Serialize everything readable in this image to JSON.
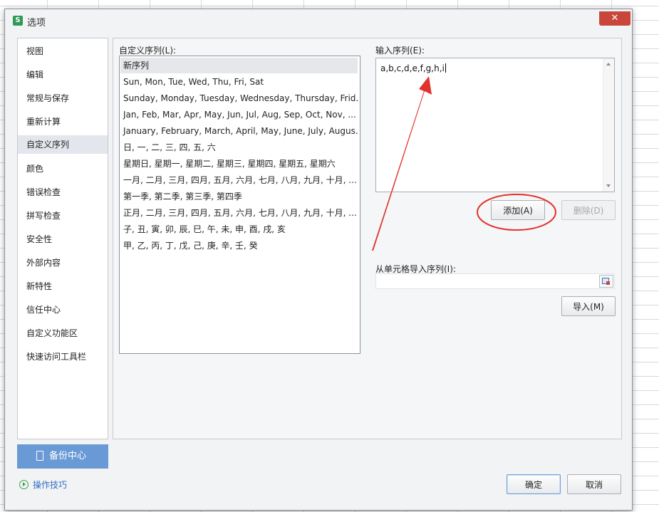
{
  "dialog": {
    "title": "选项",
    "app_icon_letter": "S",
    "close_glyph": "✕"
  },
  "nav": {
    "items": [
      {
        "label": "视图"
      },
      {
        "label": "编辑"
      },
      {
        "label": "常规与保存"
      },
      {
        "label": "重新计算"
      },
      {
        "label": "自定义序列"
      },
      {
        "label": "颜色"
      },
      {
        "label": "错误检查"
      },
      {
        "label": "拼写检查"
      },
      {
        "label": "安全性"
      },
      {
        "label": "外部内容"
      },
      {
        "label": "新特性"
      },
      {
        "label": "信任中心"
      },
      {
        "label": "自定义功能区"
      },
      {
        "label": "快速访问工具栏"
      }
    ],
    "active": "自定义序列"
  },
  "backup": {
    "label": "备份中心"
  },
  "tips": {
    "label": "操作技巧"
  },
  "custom_lists": {
    "label": "自定义序列(L):",
    "items": [
      "新序列",
      "Sun, Mon, Tue, Wed, Thu, Fri, Sat",
      "Sunday, Monday, Tuesday, Wednesday, Thursday, Frid...",
      "Jan, Feb, Mar, Apr, May, Jun, Jul, Aug, Sep, Oct, Nov, ...",
      "January, February, March, April, May, June, July, Augus...",
      "日, 一, 二, 三, 四, 五, 六",
      "星期日, 星期一, 星期二, 星期三, 星期四, 星期五, 星期六",
      "一月, 二月, 三月, 四月, 五月, 六月, 七月, 八月, 九月, 十月, ...",
      "第一季, 第二季, 第三季, 第四季",
      "正月, 二月, 三月, 四月, 五月, 六月, 七月, 八月, 九月, 十月, ...",
      "子, 丑, 寅, 卯, 辰, 巳, 午, 未, 申, 酉, 戌, 亥",
      "甲, 乙, 丙, 丁, 戊, 己, 庚, 辛, 壬, 癸"
    ],
    "selected": "新序列"
  },
  "entries": {
    "label": "输入序列(E):",
    "value": "a,b,c,d,e,f,g,h,i"
  },
  "buttons": {
    "add": "添加(A)",
    "delete": "删除(D)",
    "import": "导入(M)",
    "ok": "确定",
    "cancel": "取消"
  },
  "import_range": {
    "label": "从单元格导入序列(I):",
    "value": ""
  },
  "colors": {
    "annotation_red": "#e2322d",
    "backup_blue": "#6a9ad6",
    "link_blue": "#2f6fc1"
  }
}
